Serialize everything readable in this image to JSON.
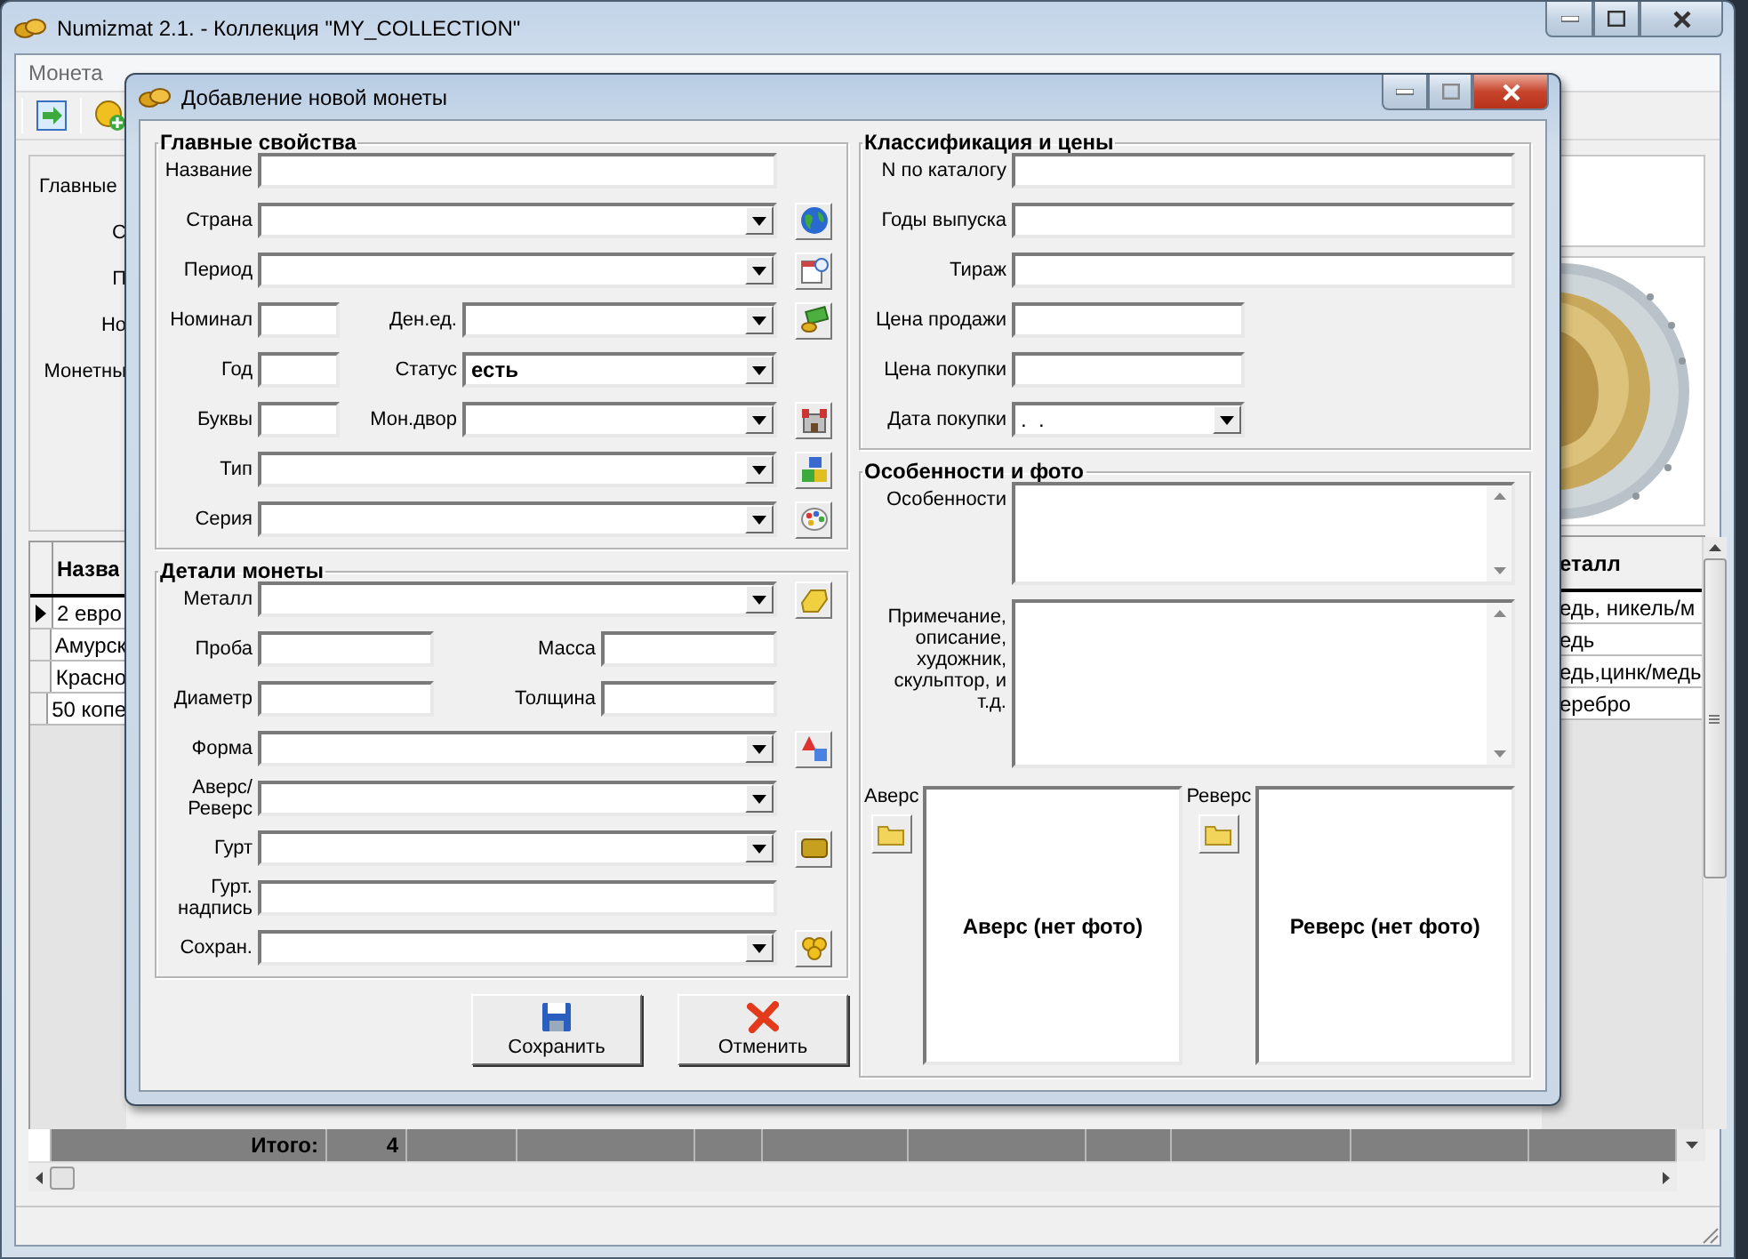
{
  "window": {
    "title": "Numizmat 2.1. - Коллекция \"MY_COLLECTION\""
  },
  "menu": [
    {
      "label": "Монета"
    }
  ],
  "side_panel": {
    "labels": [
      "Главные",
      "С",
      "П",
      "Но",
      "Монетны"
    ]
  },
  "table": {
    "left_header": "Назва",
    "right_header": "еталл",
    "rows": [
      {
        "name": "2 евро",
        "metal": "едь, никель/м",
        "selected": true
      },
      {
        "name": "Амурск",
        "metal": "едь",
        "selected": false
      },
      {
        "name": "Красно",
        "metal": "едь,цинк/медь",
        "selected": false
      },
      {
        "name": "50 копе",
        "metal": "еребро",
        "selected": false
      }
    ],
    "total_label": "Итого:",
    "total_count": "4"
  },
  "dialog": {
    "title": "Добавление новой монеты",
    "left_groups": [
      {
        "title": "Главные свойства",
        "rows": [
          {
            "kind": "text",
            "label": "Название"
          },
          {
            "kind": "combo",
            "label": "Страна"
          },
          {
            "kind": "combo",
            "label": "Период"
          },
          {
            "kind": "split",
            "label": "Номинал",
            "label2": "Ден.ед."
          },
          {
            "kind": "split",
            "label": "Год",
            "label2": "Статус",
            "value2": "есть"
          },
          {
            "kind": "split",
            "label": "Буквы",
            "label2": "Мон.двор"
          },
          {
            "kind": "combo",
            "label": "Тип"
          },
          {
            "kind": "combo",
            "label": "Серия"
          }
        ]
      },
      {
        "title": "Детали монеты",
        "rows": [
          {
            "kind": "combo",
            "label": "Металл"
          },
          {
            "kind": "pair",
            "label": "Проба",
            "label2": "Масса"
          },
          {
            "kind": "pair",
            "label": "Диаметр",
            "label2": "Толщина"
          },
          {
            "kind": "combo",
            "label": "Форма"
          },
          {
            "kind": "combo",
            "label": "Аверс/\nРеверс"
          },
          {
            "kind": "combo",
            "label": "Гурт"
          },
          {
            "kind": "text",
            "label": "Гурт.\nнадпись"
          },
          {
            "kind": "combo",
            "label": "Сохран."
          }
        ]
      }
    ],
    "classification": {
      "title": "Классификация и цены",
      "rows": [
        {
          "kind": "text",
          "label": "N по каталогу"
        },
        {
          "kind": "text",
          "label": "Годы выпуска"
        },
        {
          "kind": "text",
          "label": "Тираж"
        },
        {
          "kind": "short",
          "label": "Цена продажи"
        },
        {
          "kind": "short",
          "label": "Цена покупки"
        },
        {
          "kind": "date",
          "label": "Дата покупки",
          "value": ".  ."
        }
      ]
    },
    "features": {
      "title": "Особенности и фото",
      "memos": [
        {
          "label": "Особенности"
        },
        {
          "label": "Примечание, описание, художник, скульптор, и т.д."
        }
      ],
      "photos": [
        {
          "label": "Аверс",
          "empty_text": "Аверс (нет фото)"
        },
        {
          "label": "Реверс",
          "empty_text": "Реверс (нет фото)"
        }
      ]
    },
    "buttons": [
      {
        "label": "Сохранить",
        "kind": "save"
      },
      {
        "label": "Отменить",
        "kind": "cancel"
      }
    ]
  }
}
